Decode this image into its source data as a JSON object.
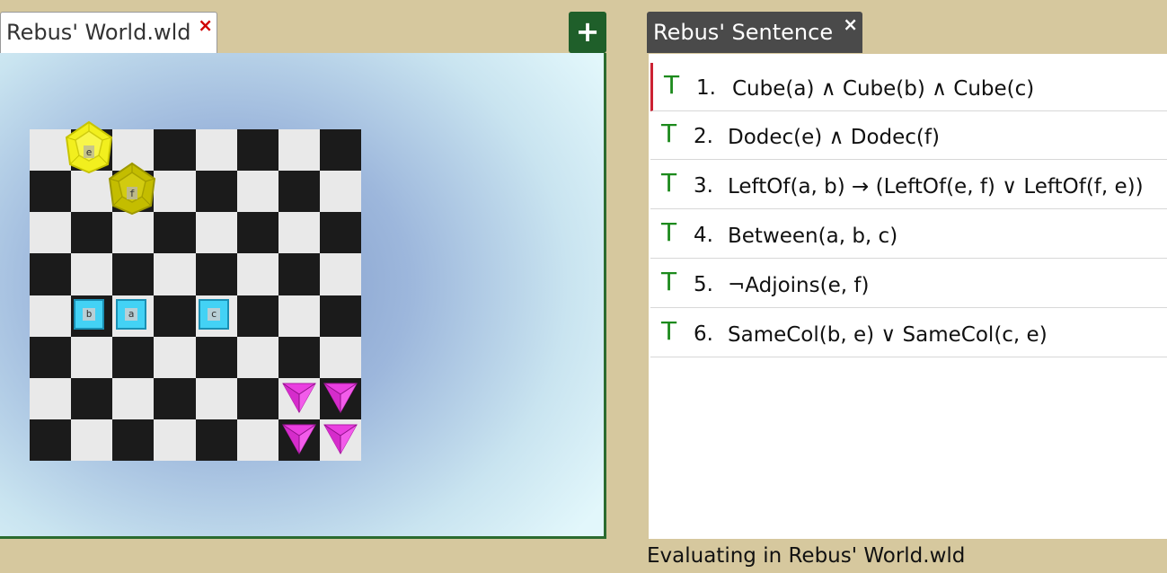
{
  "world_tab": {
    "label": "Rebus' World.wld",
    "close": "×"
  },
  "add_button": {
    "label": "+"
  },
  "sentence_tab": {
    "label": "Rebus' Sentence",
    "close": "×"
  },
  "colors": {
    "cube": "#43d2f5",
    "dodec": "#e3e11a",
    "tet": "#e83fd8",
    "truth_true": "#1c8a1c",
    "active_marker": "#cc2233"
  },
  "pieces": [
    {
      "type": "dodec",
      "name": "e",
      "label": "e",
      "color": "#f0ee1e"
    },
    {
      "type": "dodec",
      "name": "f",
      "label": "f",
      "color": "#c9c200"
    },
    {
      "type": "cube",
      "name": "b",
      "label": "b"
    },
    {
      "type": "cube",
      "name": "a",
      "label": "a"
    },
    {
      "type": "cube",
      "name": "c",
      "label": "c"
    },
    {
      "type": "tet",
      "name": "tet1",
      "label": ""
    },
    {
      "type": "tet",
      "name": "tet2",
      "label": ""
    },
    {
      "type": "tet",
      "name": "tet3",
      "label": ""
    },
    {
      "type": "tet",
      "name": "tet4",
      "label": ""
    }
  ],
  "sentences": [
    {
      "truth": "T",
      "num": "1.",
      "formula": "Cube(a) ∧ Cube(b) ∧ Cube(c)"
    },
    {
      "truth": "T",
      "num": "2.",
      "formula": "Dodec(e) ∧ Dodec(f)"
    },
    {
      "truth": "T",
      "num": "3.",
      "formula": "LeftOf(a, b) → (LeftOf(e, f) ∨ LeftOf(f, e))"
    },
    {
      "truth": "T",
      "num": "4.",
      "formula": "Between(a, b, c)"
    },
    {
      "truth": "T",
      "num": "5.",
      "formula": "¬Adjoins(e, f)"
    },
    {
      "truth": "T",
      "num": "6.",
      "formula": "SameCol(b, e) ∨ SameCol(c, e)"
    }
  ],
  "status": "Evaluating in Rebus' World.wld"
}
